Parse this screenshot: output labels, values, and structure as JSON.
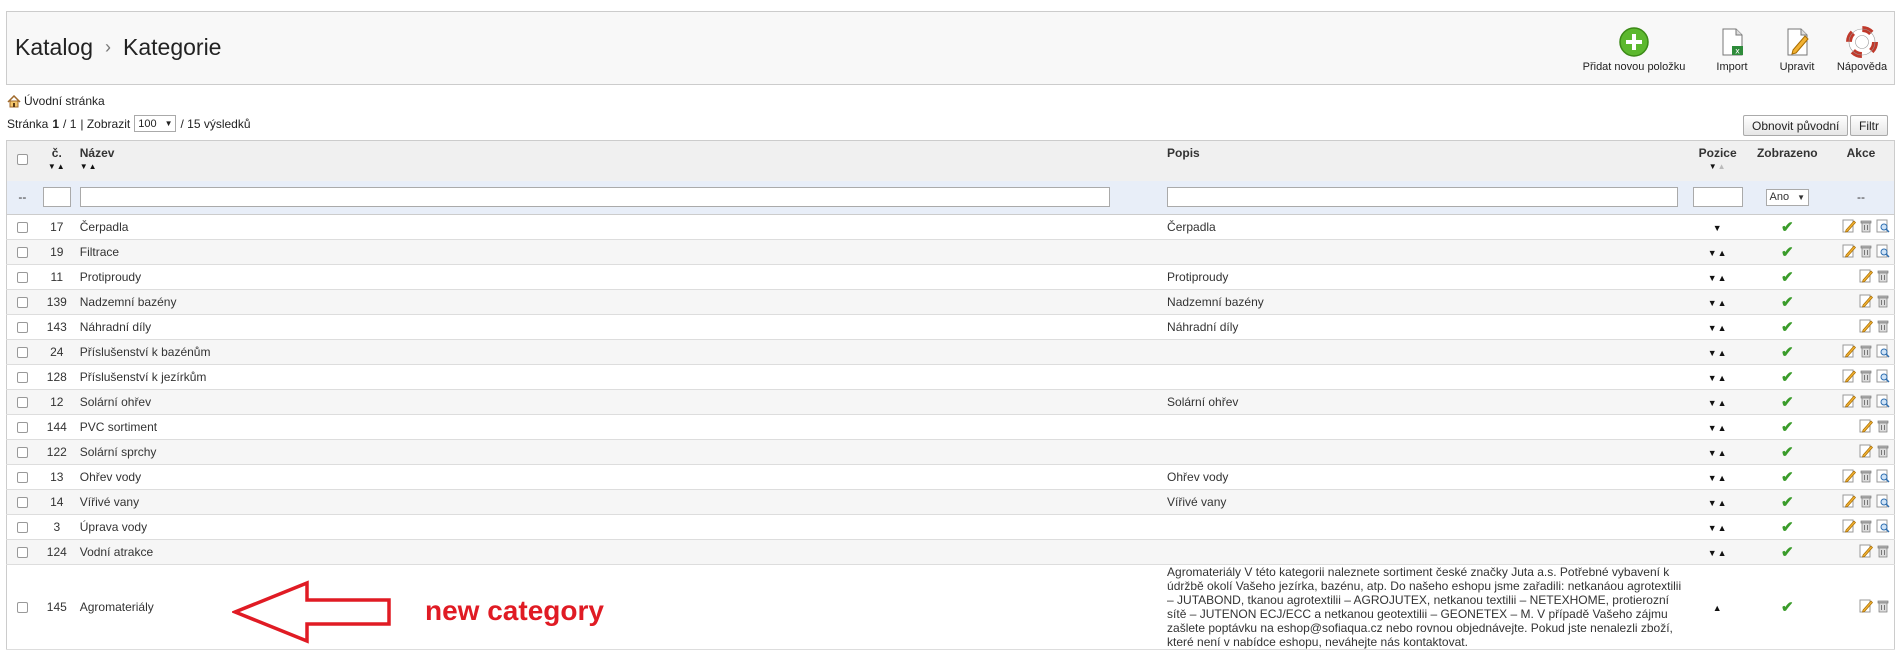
{
  "header": {
    "title_parent": "Katalog",
    "title_sep": "›",
    "title_current": "Kategorie",
    "actions": {
      "add": "Přidat novou položku",
      "import": "Import",
      "edit": "Upravit",
      "help": "Nápověda"
    }
  },
  "breadcrumb": {
    "home": "Úvodní stránka"
  },
  "pager": {
    "page_label": "Stránka",
    "page_current": "1",
    "page_total": "/ 1",
    "show_label": "| Zobrazit",
    "per_page": "100",
    "results": "/ 15 výsledků"
  },
  "buttons": {
    "reset": "Obnovit původní",
    "filter": "Filtr"
  },
  "columns": {
    "num": "č.",
    "name": "Název",
    "desc": "Popis",
    "pos": "Pozice",
    "shown": "Zobrazeno",
    "actions": "Akce"
  },
  "filter_row": {
    "chk": "--",
    "shown_value": "Ano",
    "actions": "--"
  },
  "rows": [
    {
      "id": "17",
      "name": "Čerpadla",
      "desc": "Čerpadla"
    },
    {
      "id": "19",
      "name": "Filtrace",
      "desc": ""
    },
    {
      "id": "11",
      "name": "Protiproudy",
      "desc": "Protiproudy"
    },
    {
      "id": "139",
      "name": "Nadzemní bazény",
      "desc": "Nadzemní bazény"
    },
    {
      "id": "143",
      "name": "Náhradní díly",
      "desc": "Náhradní díly"
    },
    {
      "id": "24",
      "name": "Příslušenství k bazénům",
      "desc": ""
    },
    {
      "id": "128",
      "name": "Příslušenství k jezírkům",
      "desc": ""
    },
    {
      "id": "12",
      "name": "Solární ohřev",
      "desc": "Solární ohřev"
    },
    {
      "id": "144",
      "name": "PVC sortiment",
      "desc": ""
    },
    {
      "id": "122",
      "name": "Solární sprchy",
      "desc": ""
    },
    {
      "id": "13",
      "name": "Ohřev vody",
      "desc": "Ohřev vody"
    },
    {
      "id": "14",
      "name": "Vířivé vany",
      "desc": "Vířivé vany"
    },
    {
      "id": "3",
      "name": "Úprava vody",
      "desc": ""
    },
    {
      "id": "124",
      "name": "Vodní atrakce",
      "desc": ""
    },
    {
      "id": "145",
      "name": "Agromateriály",
      "desc": "Agromateriály V této kategorii naleznete sortiment české značky Juta a.s. Potřebné vybavení k údržbě okolí Vašeho jezírka, bazénu, atp. Do našeho eshopu jsme zařadili: netkanáou agrotextilii – JUTABOND, tkanou agrotextilii – AGROJUTEX, netkanou textilii – NETEXHOME, protierozní sítě – JUTENON ECJ/ECC a netkanou geotextilii – GEONETEX – M. V případě Vašeho zájmu zašlete poptávku na eshop@sofiaqua.cz nebo rovnou objednávejte. Pokud jste nenalezli zboží, které není v nabídce eshopu, neváhejte nás kontaktovat."
    }
  ],
  "annotation": {
    "text": "new category"
  }
}
